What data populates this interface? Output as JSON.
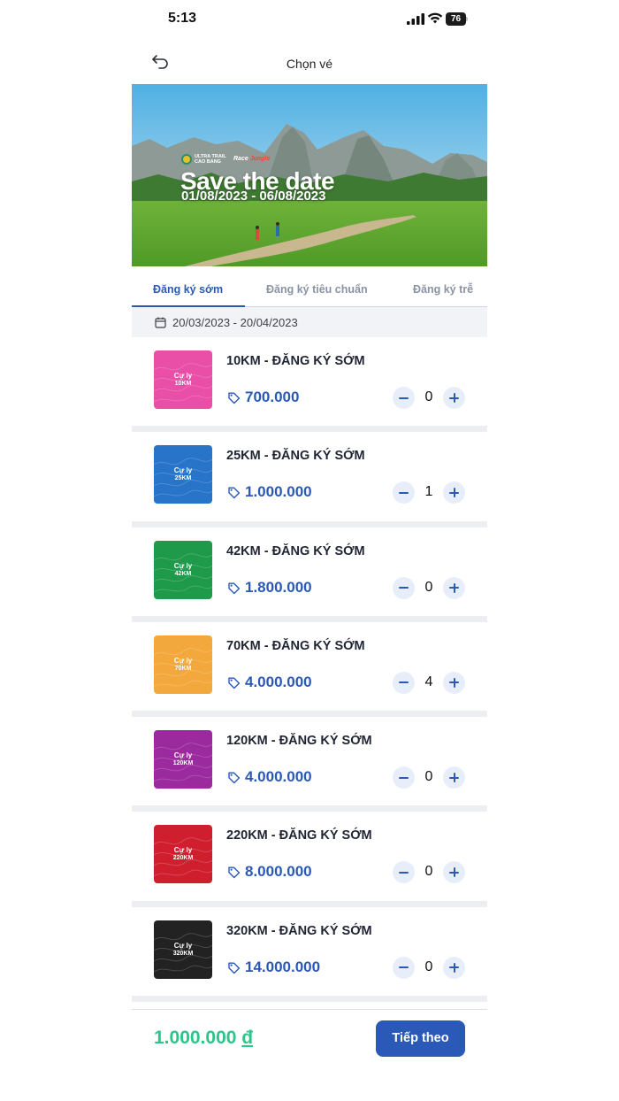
{
  "status_bar": {
    "time": "5:13",
    "battery": "76"
  },
  "nav": {
    "title": "Chọn vé",
    "back_icon": "back-arrow-icon"
  },
  "banner": {
    "headline": "Save the date",
    "dates": "01/08/2023 - 06/08/2023",
    "logo_ultra_line1": "ULTRA TRAIL",
    "logo_ultra_line2": "CAO BANG",
    "logo_race": "Race",
    "logo_race_accent": "Jungle"
  },
  "tabs": [
    {
      "label": "Đăng ký sớm",
      "active": true
    },
    {
      "label": "Đăng ký tiêu chuẩn",
      "active": false
    },
    {
      "label": "Đăng ký trễ",
      "active": false
    }
  ],
  "date_range": "20/03/2023 - 20/04/2023",
  "tickets": [
    {
      "thumb_line1": "Cự ly",
      "thumb_line2": "10KM",
      "name": "10KM - ĐĂNG KÝ SỚM",
      "price": "700.000",
      "qty": "0",
      "color": "#e94fa6"
    },
    {
      "thumb_line1": "Cự ly",
      "thumb_line2": "25KM",
      "name": "25KM - ĐĂNG KÝ SỚM",
      "price": "1.000.000",
      "qty": "1",
      "color": "#2774c9"
    },
    {
      "thumb_line1": "Cự ly",
      "thumb_line2": "42KM",
      "name": "42KM - ĐĂNG KÝ SỚM",
      "price": "1.800.000",
      "qty": "0",
      "color": "#1f9a4a"
    },
    {
      "thumb_line1": "Cự ly",
      "thumb_line2": "70KM",
      "name": "70KM - ĐĂNG KÝ SỚM",
      "price": "4.000.000",
      "qty": "4",
      "color": "#f2a83c"
    },
    {
      "thumb_line1": "Cự ly",
      "thumb_line2": "120KM",
      "name": "120KM - ĐĂNG KÝ SỚM",
      "price": "4.000.000",
      "qty": "0",
      "color": "#9a2a9e"
    },
    {
      "thumb_line1": "Cự ly",
      "thumb_line2": "220KM",
      "name": "220KM - ĐĂNG KÝ SỚM",
      "price": "8.000.000",
      "qty": "0",
      "color": "#cf1f2f"
    },
    {
      "thumb_line1": "Cự ly",
      "thumb_line2": "320KM",
      "name": "320KM - ĐĂNG KÝ SỚM",
      "price": "14.000.000",
      "qty": "0",
      "color": "#222222"
    }
  ],
  "footer": {
    "total": "1.000.000",
    "currency": "đ",
    "next_label": "Tiếp theo"
  },
  "colors": {
    "accent": "#2b59b7",
    "total": "#2cc58a"
  }
}
